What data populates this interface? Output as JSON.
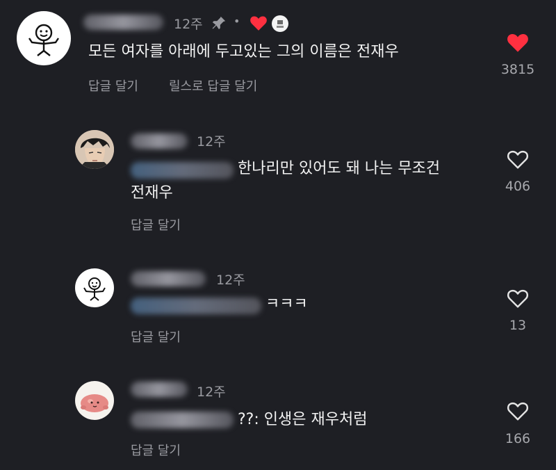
{
  "comments": [
    {
      "time": "12주",
      "pinned_icon": "pin-icon",
      "separator": "•",
      "creator_liked_icon": "heart-filled-icon",
      "text": "모든 여자를 아래에 두고있는 그의 이름은 전재우",
      "reply_label": "답글 달기",
      "reels_reply_label": "릴스로 답글 달기",
      "like_count": "3815",
      "liked": true
    },
    {
      "time": "12주",
      "text_line1": "한나리만 있어도 돼 나는 무조건",
      "text_line2": "전재우",
      "reply_label": "답글 달기",
      "like_count": "406",
      "liked": false
    },
    {
      "time": "12주",
      "text": "ㅋㅋㅋ",
      "reply_label": "답글 달기",
      "like_count": "13",
      "liked": false
    },
    {
      "time": "12주",
      "text": "??: 인생은 재우처럼",
      "reply_label": "답글 달기",
      "like_count": "166",
      "liked": false
    }
  ],
  "colors": {
    "background": "#1e1f24",
    "like_red": "#ff3040",
    "muted_text": "#9a9ba1"
  }
}
